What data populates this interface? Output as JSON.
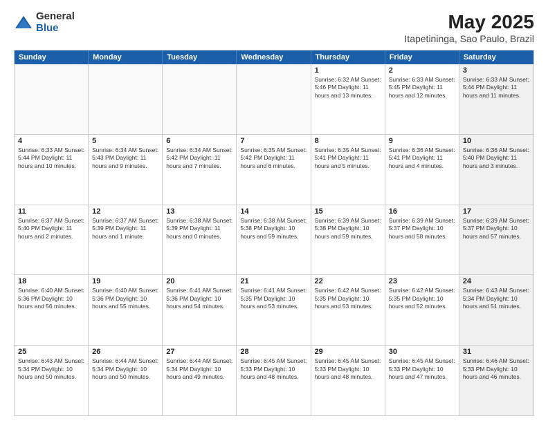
{
  "logo": {
    "general": "General",
    "blue": "Blue"
  },
  "header": {
    "title": "May 2025",
    "subtitle": "Itapetininga, Sao Paulo, Brazil"
  },
  "weekdays": [
    "Sunday",
    "Monday",
    "Tuesday",
    "Wednesday",
    "Thursday",
    "Friday",
    "Saturday"
  ],
  "rows": [
    [
      {
        "day": "",
        "info": "",
        "empty": true
      },
      {
        "day": "",
        "info": "",
        "empty": true
      },
      {
        "day": "",
        "info": "",
        "empty": true
      },
      {
        "day": "",
        "info": "",
        "empty": true
      },
      {
        "day": "1",
        "info": "Sunrise: 6:32 AM\nSunset: 5:46 PM\nDaylight: 11 hours\nand 13 minutes."
      },
      {
        "day": "2",
        "info": "Sunrise: 6:33 AM\nSunset: 5:45 PM\nDaylight: 11 hours\nand 12 minutes."
      },
      {
        "day": "3",
        "info": "Sunrise: 6:33 AM\nSunset: 5:44 PM\nDaylight: 11 hours\nand 11 minutes.",
        "shaded": true
      }
    ],
    [
      {
        "day": "4",
        "info": "Sunrise: 6:33 AM\nSunset: 5:44 PM\nDaylight: 11 hours\nand 10 minutes."
      },
      {
        "day": "5",
        "info": "Sunrise: 6:34 AM\nSunset: 5:43 PM\nDaylight: 11 hours\nand 9 minutes."
      },
      {
        "day": "6",
        "info": "Sunrise: 6:34 AM\nSunset: 5:42 PM\nDaylight: 11 hours\nand 7 minutes."
      },
      {
        "day": "7",
        "info": "Sunrise: 6:35 AM\nSunset: 5:42 PM\nDaylight: 11 hours\nand 6 minutes."
      },
      {
        "day": "8",
        "info": "Sunrise: 6:35 AM\nSunset: 5:41 PM\nDaylight: 11 hours\nand 5 minutes."
      },
      {
        "day": "9",
        "info": "Sunrise: 6:36 AM\nSunset: 5:41 PM\nDaylight: 11 hours\nand 4 minutes."
      },
      {
        "day": "10",
        "info": "Sunrise: 6:36 AM\nSunset: 5:40 PM\nDaylight: 11 hours\nand 3 minutes.",
        "shaded": true
      }
    ],
    [
      {
        "day": "11",
        "info": "Sunrise: 6:37 AM\nSunset: 5:40 PM\nDaylight: 11 hours\nand 2 minutes."
      },
      {
        "day": "12",
        "info": "Sunrise: 6:37 AM\nSunset: 5:39 PM\nDaylight: 11 hours\nand 1 minute."
      },
      {
        "day": "13",
        "info": "Sunrise: 6:38 AM\nSunset: 5:39 PM\nDaylight: 11 hours\nand 0 minutes."
      },
      {
        "day": "14",
        "info": "Sunrise: 6:38 AM\nSunset: 5:38 PM\nDaylight: 10 hours\nand 59 minutes."
      },
      {
        "day": "15",
        "info": "Sunrise: 6:39 AM\nSunset: 5:38 PM\nDaylight: 10 hours\nand 59 minutes."
      },
      {
        "day": "16",
        "info": "Sunrise: 6:39 AM\nSunset: 5:37 PM\nDaylight: 10 hours\nand 58 minutes."
      },
      {
        "day": "17",
        "info": "Sunrise: 6:39 AM\nSunset: 5:37 PM\nDaylight: 10 hours\nand 57 minutes.",
        "shaded": true
      }
    ],
    [
      {
        "day": "18",
        "info": "Sunrise: 6:40 AM\nSunset: 5:36 PM\nDaylight: 10 hours\nand 56 minutes."
      },
      {
        "day": "19",
        "info": "Sunrise: 6:40 AM\nSunset: 5:36 PM\nDaylight: 10 hours\nand 55 minutes."
      },
      {
        "day": "20",
        "info": "Sunrise: 6:41 AM\nSunset: 5:36 PM\nDaylight: 10 hours\nand 54 minutes."
      },
      {
        "day": "21",
        "info": "Sunrise: 6:41 AM\nSunset: 5:35 PM\nDaylight: 10 hours\nand 53 minutes."
      },
      {
        "day": "22",
        "info": "Sunrise: 6:42 AM\nSunset: 5:35 PM\nDaylight: 10 hours\nand 53 minutes."
      },
      {
        "day": "23",
        "info": "Sunrise: 6:42 AM\nSunset: 5:35 PM\nDaylight: 10 hours\nand 52 minutes."
      },
      {
        "day": "24",
        "info": "Sunrise: 6:43 AM\nSunset: 5:34 PM\nDaylight: 10 hours\nand 51 minutes.",
        "shaded": true
      }
    ],
    [
      {
        "day": "25",
        "info": "Sunrise: 6:43 AM\nSunset: 5:34 PM\nDaylight: 10 hours\nand 50 minutes."
      },
      {
        "day": "26",
        "info": "Sunrise: 6:44 AM\nSunset: 5:34 PM\nDaylight: 10 hours\nand 50 minutes."
      },
      {
        "day": "27",
        "info": "Sunrise: 6:44 AM\nSunset: 5:34 PM\nDaylight: 10 hours\nand 49 minutes."
      },
      {
        "day": "28",
        "info": "Sunrise: 6:45 AM\nSunset: 5:33 PM\nDaylight: 10 hours\nand 48 minutes."
      },
      {
        "day": "29",
        "info": "Sunrise: 6:45 AM\nSunset: 5:33 PM\nDaylight: 10 hours\nand 48 minutes."
      },
      {
        "day": "30",
        "info": "Sunrise: 6:45 AM\nSunset: 5:33 PM\nDaylight: 10 hours\nand 47 minutes."
      },
      {
        "day": "31",
        "info": "Sunrise: 6:46 AM\nSunset: 5:33 PM\nDaylight: 10 hours\nand 46 minutes.",
        "shaded": true
      }
    ]
  ]
}
